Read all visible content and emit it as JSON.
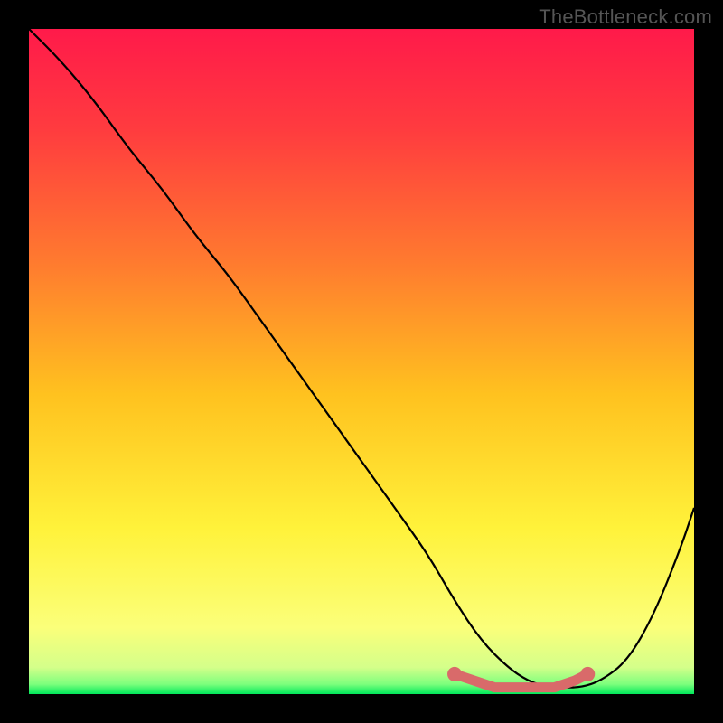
{
  "watermark": "TheBottleneck.com",
  "chart_data": {
    "type": "line",
    "title": "",
    "xlabel": "",
    "ylabel": "",
    "xlim": [
      0,
      100
    ],
    "ylim": [
      0,
      100
    ],
    "series": [
      {
        "name": "bottleneck-curve",
        "x": [
          0,
          5,
          10,
          15,
          20,
          25,
          30,
          35,
          40,
          45,
          50,
          55,
          60,
          64,
          68,
          72,
          75,
          78,
          80,
          83,
          86,
          90,
          94,
          98,
          100
        ],
        "values": [
          100,
          95,
          89,
          82,
          76,
          69,
          63,
          56,
          49,
          42,
          35,
          28,
          21,
          14,
          8,
          4,
          2,
          1,
          1,
          1,
          2,
          5,
          12,
          22,
          28
        ]
      }
    ],
    "optimal_zone": {
      "name": "optimal-markers",
      "x": [
        64,
        67,
        70,
        73,
        76,
        79,
        82,
        84
      ],
      "values": [
        3,
        2,
        1,
        1,
        1,
        1,
        2,
        3
      ]
    },
    "background_gradient": {
      "type": "vertical",
      "stops": [
        {
          "pos": 0.0,
          "color": "#ff1a4a"
        },
        {
          "pos": 0.15,
          "color": "#ff3b3f"
        },
        {
          "pos": 0.35,
          "color": "#ff7a2f"
        },
        {
          "pos": 0.55,
          "color": "#ffc21f"
        },
        {
          "pos": 0.75,
          "color": "#fff23a"
        },
        {
          "pos": 0.9,
          "color": "#fbff7a"
        },
        {
          "pos": 0.96,
          "color": "#d4ff8a"
        },
        {
          "pos": 0.985,
          "color": "#7dff7d"
        },
        {
          "pos": 1.0,
          "color": "#00e85a"
        }
      ]
    },
    "marker_color": "#d96a6a",
    "curve_color": "#000000"
  }
}
